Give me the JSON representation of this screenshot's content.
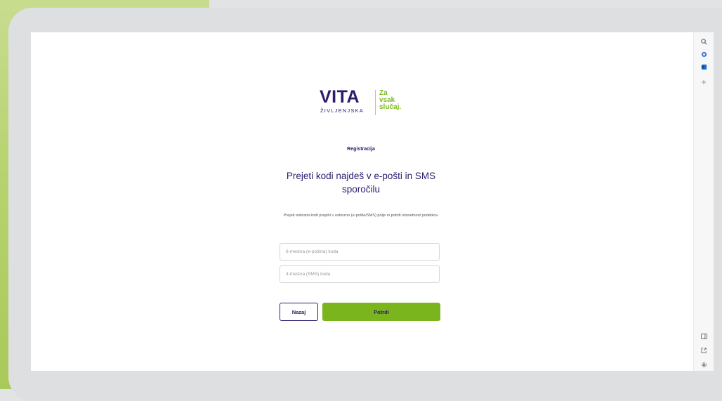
{
  "brand": {
    "name": "VITA",
    "subtitle": "ŽIVLJENJSKA",
    "tagline": [
      "Za",
      "vsak",
      "slučaj."
    ]
  },
  "form": {
    "step_label": "Registracija",
    "heading": "Prejeti kodi najdeš v e-pošti in SMS sporočilu",
    "description": "Prejeti enkratni kodi prepiši v ustrezno (e-pošta/SMS) polje in potrdi istovetnost podatkov.",
    "email_code_placeholder": "6-mestna (e-poštna) koda",
    "sms_code_placeholder": "4-mestna (SMS) koda",
    "back_label": "Nazaj",
    "confirm_label": "Potrdi"
  },
  "sidebar_icons": [
    "search-icon",
    "extension-icon",
    "outlook-icon",
    "plus-icon",
    "sidebar-toggle-icon",
    "open-external-icon",
    "settings-icon"
  ],
  "colors": {
    "brand_purple": "#2e1a6e",
    "brand_green": "#7ab51e",
    "tagline_green": "#7fba1f",
    "accent_strip": "#b7d36f"
  }
}
